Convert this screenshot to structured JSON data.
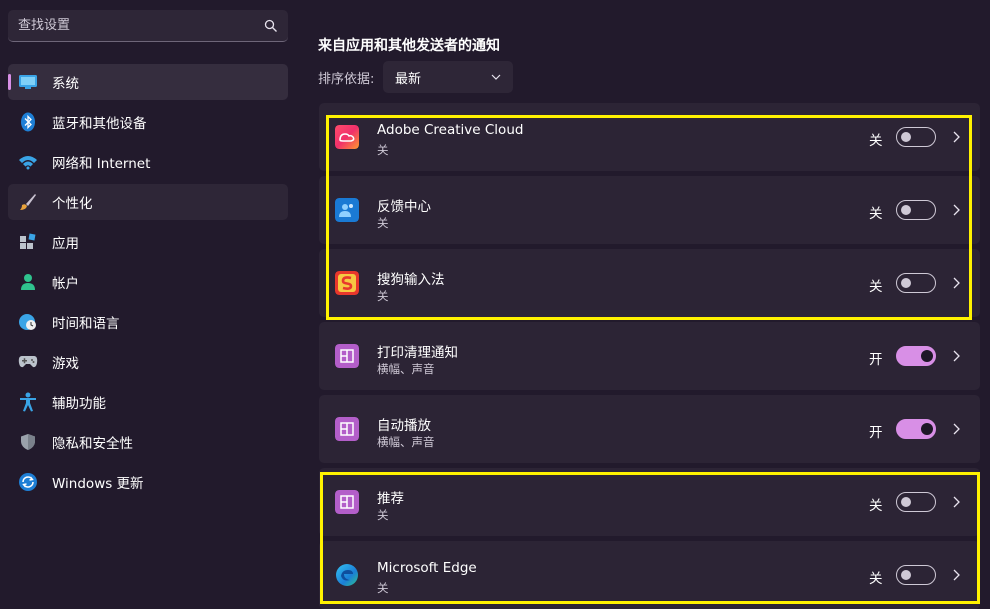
{
  "search": {
    "placeholder": "查找设置",
    "icon": "search-icon"
  },
  "sidebar": {
    "items": [
      {
        "label": "系统",
        "icon": "monitor-icon",
        "selected": true
      },
      {
        "label": "蓝牙和其他设备",
        "icon": "bluetooth-icon"
      },
      {
        "label": "网络和 Internet",
        "icon": "wifi-icon"
      },
      {
        "label": "个性化",
        "icon": "brush-icon",
        "hover": true
      },
      {
        "label": "应用",
        "icon": "apps-icon"
      },
      {
        "label": "帐户",
        "icon": "person-icon"
      },
      {
        "label": "时间和语言",
        "icon": "globe-clock-icon"
      },
      {
        "label": "游戏",
        "icon": "gamepad-icon"
      },
      {
        "label": "辅助功能",
        "icon": "accessibility-icon"
      },
      {
        "label": "隐私和安全性",
        "icon": "shield-icon"
      },
      {
        "label": "Windows 更新",
        "icon": "update-icon"
      }
    ]
  },
  "main": {
    "section_title": "来自应用和其他发送者的通知",
    "sort_label": "排序依据:",
    "sort_value": "最新",
    "apps": [
      {
        "name": "Adobe Creative Cloud",
        "sub": "关",
        "state": "关",
        "on": false,
        "icon": "adobe-cc-icon"
      },
      {
        "name": "反馈中心",
        "sub": "关",
        "state": "关",
        "on": false,
        "icon": "feedback-hub-icon"
      },
      {
        "name": "搜狗输入法",
        "sub": "关",
        "state": "关",
        "on": false,
        "icon": "sogou-icon"
      },
      {
        "name": "打印清理通知",
        "sub": "横幅、声音",
        "state": "开",
        "on": true,
        "icon": "generic-app-icon"
      },
      {
        "name": "自动播放",
        "sub": "横幅、声音",
        "state": "开",
        "on": true,
        "icon": "generic-app-icon"
      },
      {
        "name": "推荐",
        "sub": "关",
        "state": "关",
        "on": false,
        "icon": "generic-app-icon"
      },
      {
        "name": "Microsoft Edge",
        "sub": "关",
        "state": "关",
        "on": false,
        "icon": "edge-icon"
      }
    ]
  },
  "colors": {
    "accent": "#d88fe6",
    "highlight": "#fff200",
    "background": "#221a2c",
    "card": "#2c2435"
  }
}
